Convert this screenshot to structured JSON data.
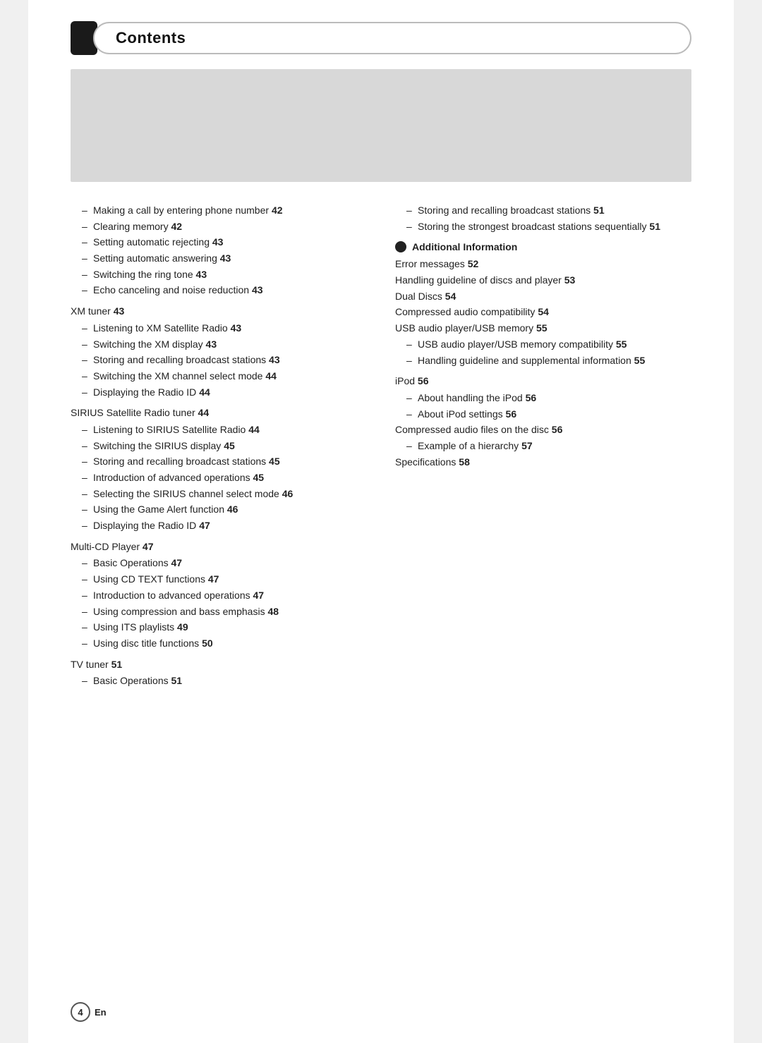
{
  "header": {
    "title": "Contents"
  },
  "footer": {
    "page_num": "4",
    "lang": "En"
  },
  "left_col": {
    "entries": [
      {
        "type": "sub",
        "text": "Making a call by entering phone number",
        "page": "42"
      },
      {
        "type": "sub",
        "text": "Clearing memory",
        "page": "42"
      },
      {
        "type": "sub",
        "text": "Setting automatic rejecting",
        "page": "43"
      },
      {
        "type": "sub",
        "text": "Setting automatic answering",
        "page": "43"
      },
      {
        "type": "sub",
        "text": "Switching the ring tone",
        "page": "43"
      },
      {
        "type": "sub",
        "text": "Echo canceling and noise reduction",
        "page": "43"
      },
      {
        "type": "section",
        "text": "XM tuner",
        "page": "43"
      },
      {
        "type": "sub",
        "text": "Listening to XM Satellite Radio",
        "page": "43"
      },
      {
        "type": "sub",
        "text": "Switching the XM display",
        "page": "43"
      },
      {
        "type": "sub",
        "text": "Storing and recalling broadcast stations",
        "page": "43"
      },
      {
        "type": "sub",
        "text": "Switching the XM channel select mode",
        "page": "44"
      },
      {
        "type": "sub",
        "text": "Displaying the Radio ID",
        "page": "44"
      },
      {
        "type": "section",
        "text": "SIRIUS Satellite Radio tuner",
        "page": "44"
      },
      {
        "type": "sub",
        "text": "Listening to SIRIUS Satellite Radio",
        "page": "44"
      },
      {
        "type": "sub",
        "text": "Switching the SIRIUS display",
        "page": "45"
      },
      {
        "type": "sub",
        "text": "Storing and recalling broadcast stations",
        "page": "45"
      },
      {
        "type": "sub",
        "text": "Introduction of advanced operations",
        "page": "45"
      },
      {
        "type": "sub",
        "text": "Selecting the SIRIUS channel select mode",
        "page": "46"
      },
      {
        "type": "sub",
        "text": "Using the Game Alert function",
        "page": "46"
      },
      {
        "type": "sub",
        "text": "Displaying the Radio ID",
        "page": "47"
      },
      {
        "type": "section",
        "text": "Multi-CD Player",
        "page": "47"
      },
      {
        "type": "sub",
        "text": "Basic Operations",
        "page": "47"
      },
      {
        "type": "sub",
        "text": "Using CD TEXT functions",
        "page": "47"
      },
      {
        "type": "sub",
        "text": "Introduction to advanced operations",
        "page": "47"
      },
      {
        "type": "sub",
        "text": "Using compression and bass emphasis",
        "page": "48"
      },
      {
        "type": "sub",
        "text": "Using ITS playlists",
        "page": "49"
      },
      {
        "type": "sub",
        "text": "Using disc title functions",
        "page": "50"
      },
      {
        "type": "section",
        "text": "TV tuner",
        "page": "51"
      },
      {
        "type": "sub",
        "text": "Basic Operations",
        "page": "51"
      }
    ]
  },
  "right_col": {
    "top_entries": [
      {
        "type": "sub",
        "text": "Storing and recalling broadcast stations",
        "page": "51"
      },
      {
        "type": "sub",
        "text": "Storing the strongest broadcast stations sequentially",
        "page": "51"
      }
    ],
    "additional_info_heading": "Additional Information",
    "additional_entries": [
      {
        "type": "plain",
        "text": "Error messages",
        "page": "52"
      },
      {
        "type": "plain",
        "text": "Handling guideline of discs and player",
        "page": "53"
      },
      {
        "type": "plain",
        "text": "Dual Discs",
        "page": "54"
      },
      {
        "type": "plain",
        "text": "Compressed audio compatibility",
        "page": "54"
      },
      {
        "type": "plain",
        "text": "USB audio player/USB memory",
        "page": "55"
      },
      {
        "type": "sub2",
        "text": "USB audio player/USB memory compatibility",
        "page": "55"
      },
      {
        "type": "sub2",
        "text": "Handling guideline and supplemental information",
        "page": "55"
      },
      {
        "type": "section",
        "text": "iPod",
        "page": "56"
      },
      {
        "type": "sub2",
        "text": "About handling the iPod",
        "page": "56"
      },
      {
        "type": "sub2",
        "text": "About iPod settings",
        "page": "56"
      },
      {
        "type": "plain",
        "text": "Compressed audio files on the disc",
        "page": "56"
      },
      {
        "type": "sub2",
        "text": "Example of a hierarchy",
        "page": "57"
      },
      {
        "type": "plain",
        "text": "Specifications",
        "page": "58"
      }
    ]
  }
}
